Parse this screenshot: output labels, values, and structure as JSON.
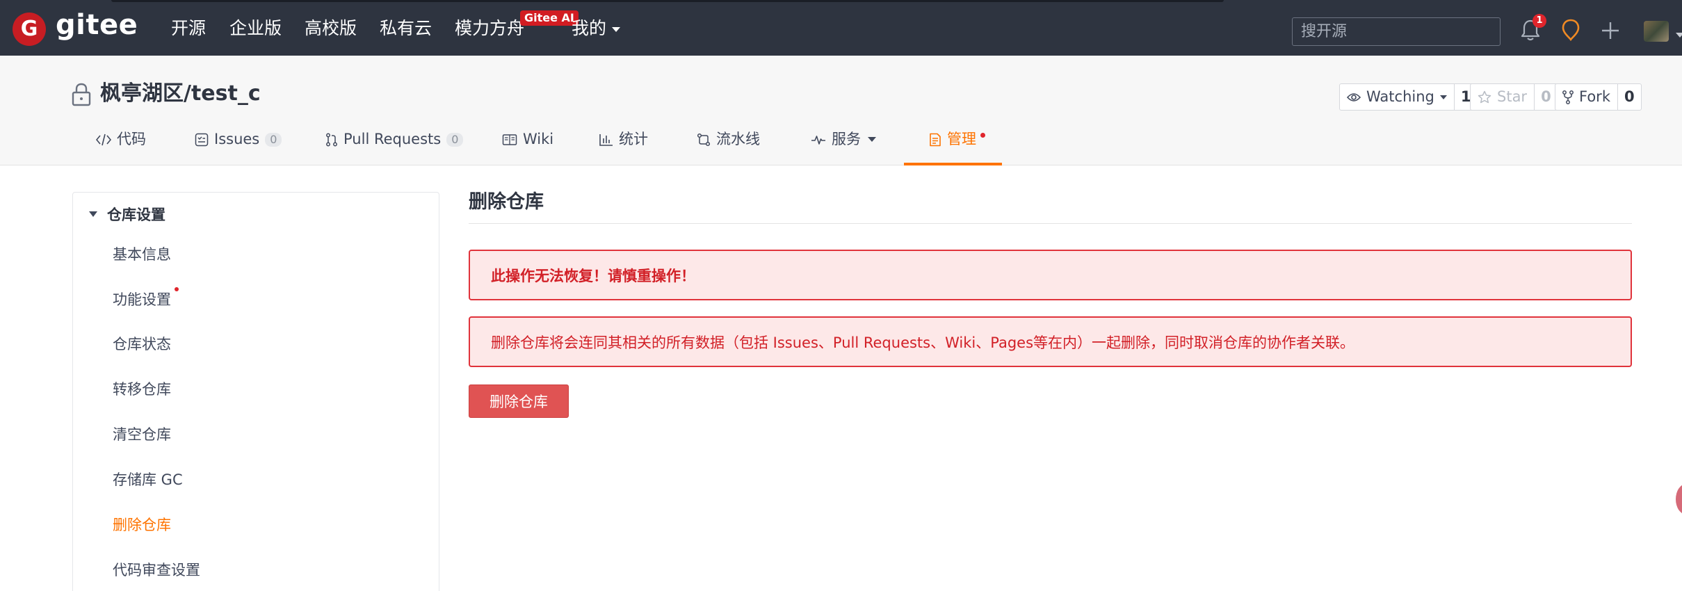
{
  "topnav": {
    "logo_letter": "G",
    "brand": "gitee",
    "items": [
      "开源",
      "企业版",
      "高校版",
      "私有云",
      "模力方舟"
    ],
    "ai_badge": "Gitee AI",
    "mine": "我的",
    "search_placeholder": "搜开源",
    "notification_count": "1"
  },
  "repo": {
    "title": "枫亭湖区/test_c",
    "watch": {
      "label": "Watching",
      "count": "1"
    },
    "star": {
      "label": "Star",
      "count": "0"
    },
    "fork": {
      "label": "Fork",
      "count": "0"
    }
  },
  "tabs": {
    "code": "代码",
    "issues": "Issues",
    "issues_count": "0",
    "pulls": "Pull Requests",
    "pulls_count": "0",
    "wiki": "Wiki",
    "stats": "统计",
    "pipeline": "流水线",
    "services": "服务",
    "manage": "管理"
  },
  "sidebar": {
    "heading": "仓库设置",
    "items": [
      "基本信息",
      "功能设置",
      "仓库状态",
      "转移仓库",
      "清空仓库",
      "存储库 GC",
      "删除仓库",
      "代码审查设置"
    ]
  },
  "main": {
    "title": "删除仓库",
    "warning": "此操作无法恢复！请慎重操作！",
    "description": "删除仓库将会连同其相关的所有数据（包括 Issues、Pull Requests、Wiki、Pages等在内）一起删除，同时取消仓库的协作者关联。",
    "delete_button": "删除仓库"
  },
  "colors": {
    "nav_bg": "#2e3440",
    "accent": "#fe7300",
    "danger": "#e05353",
    "alert_bg": "#fde8e8",
    "alert_text": "#d22027"
  }
}
